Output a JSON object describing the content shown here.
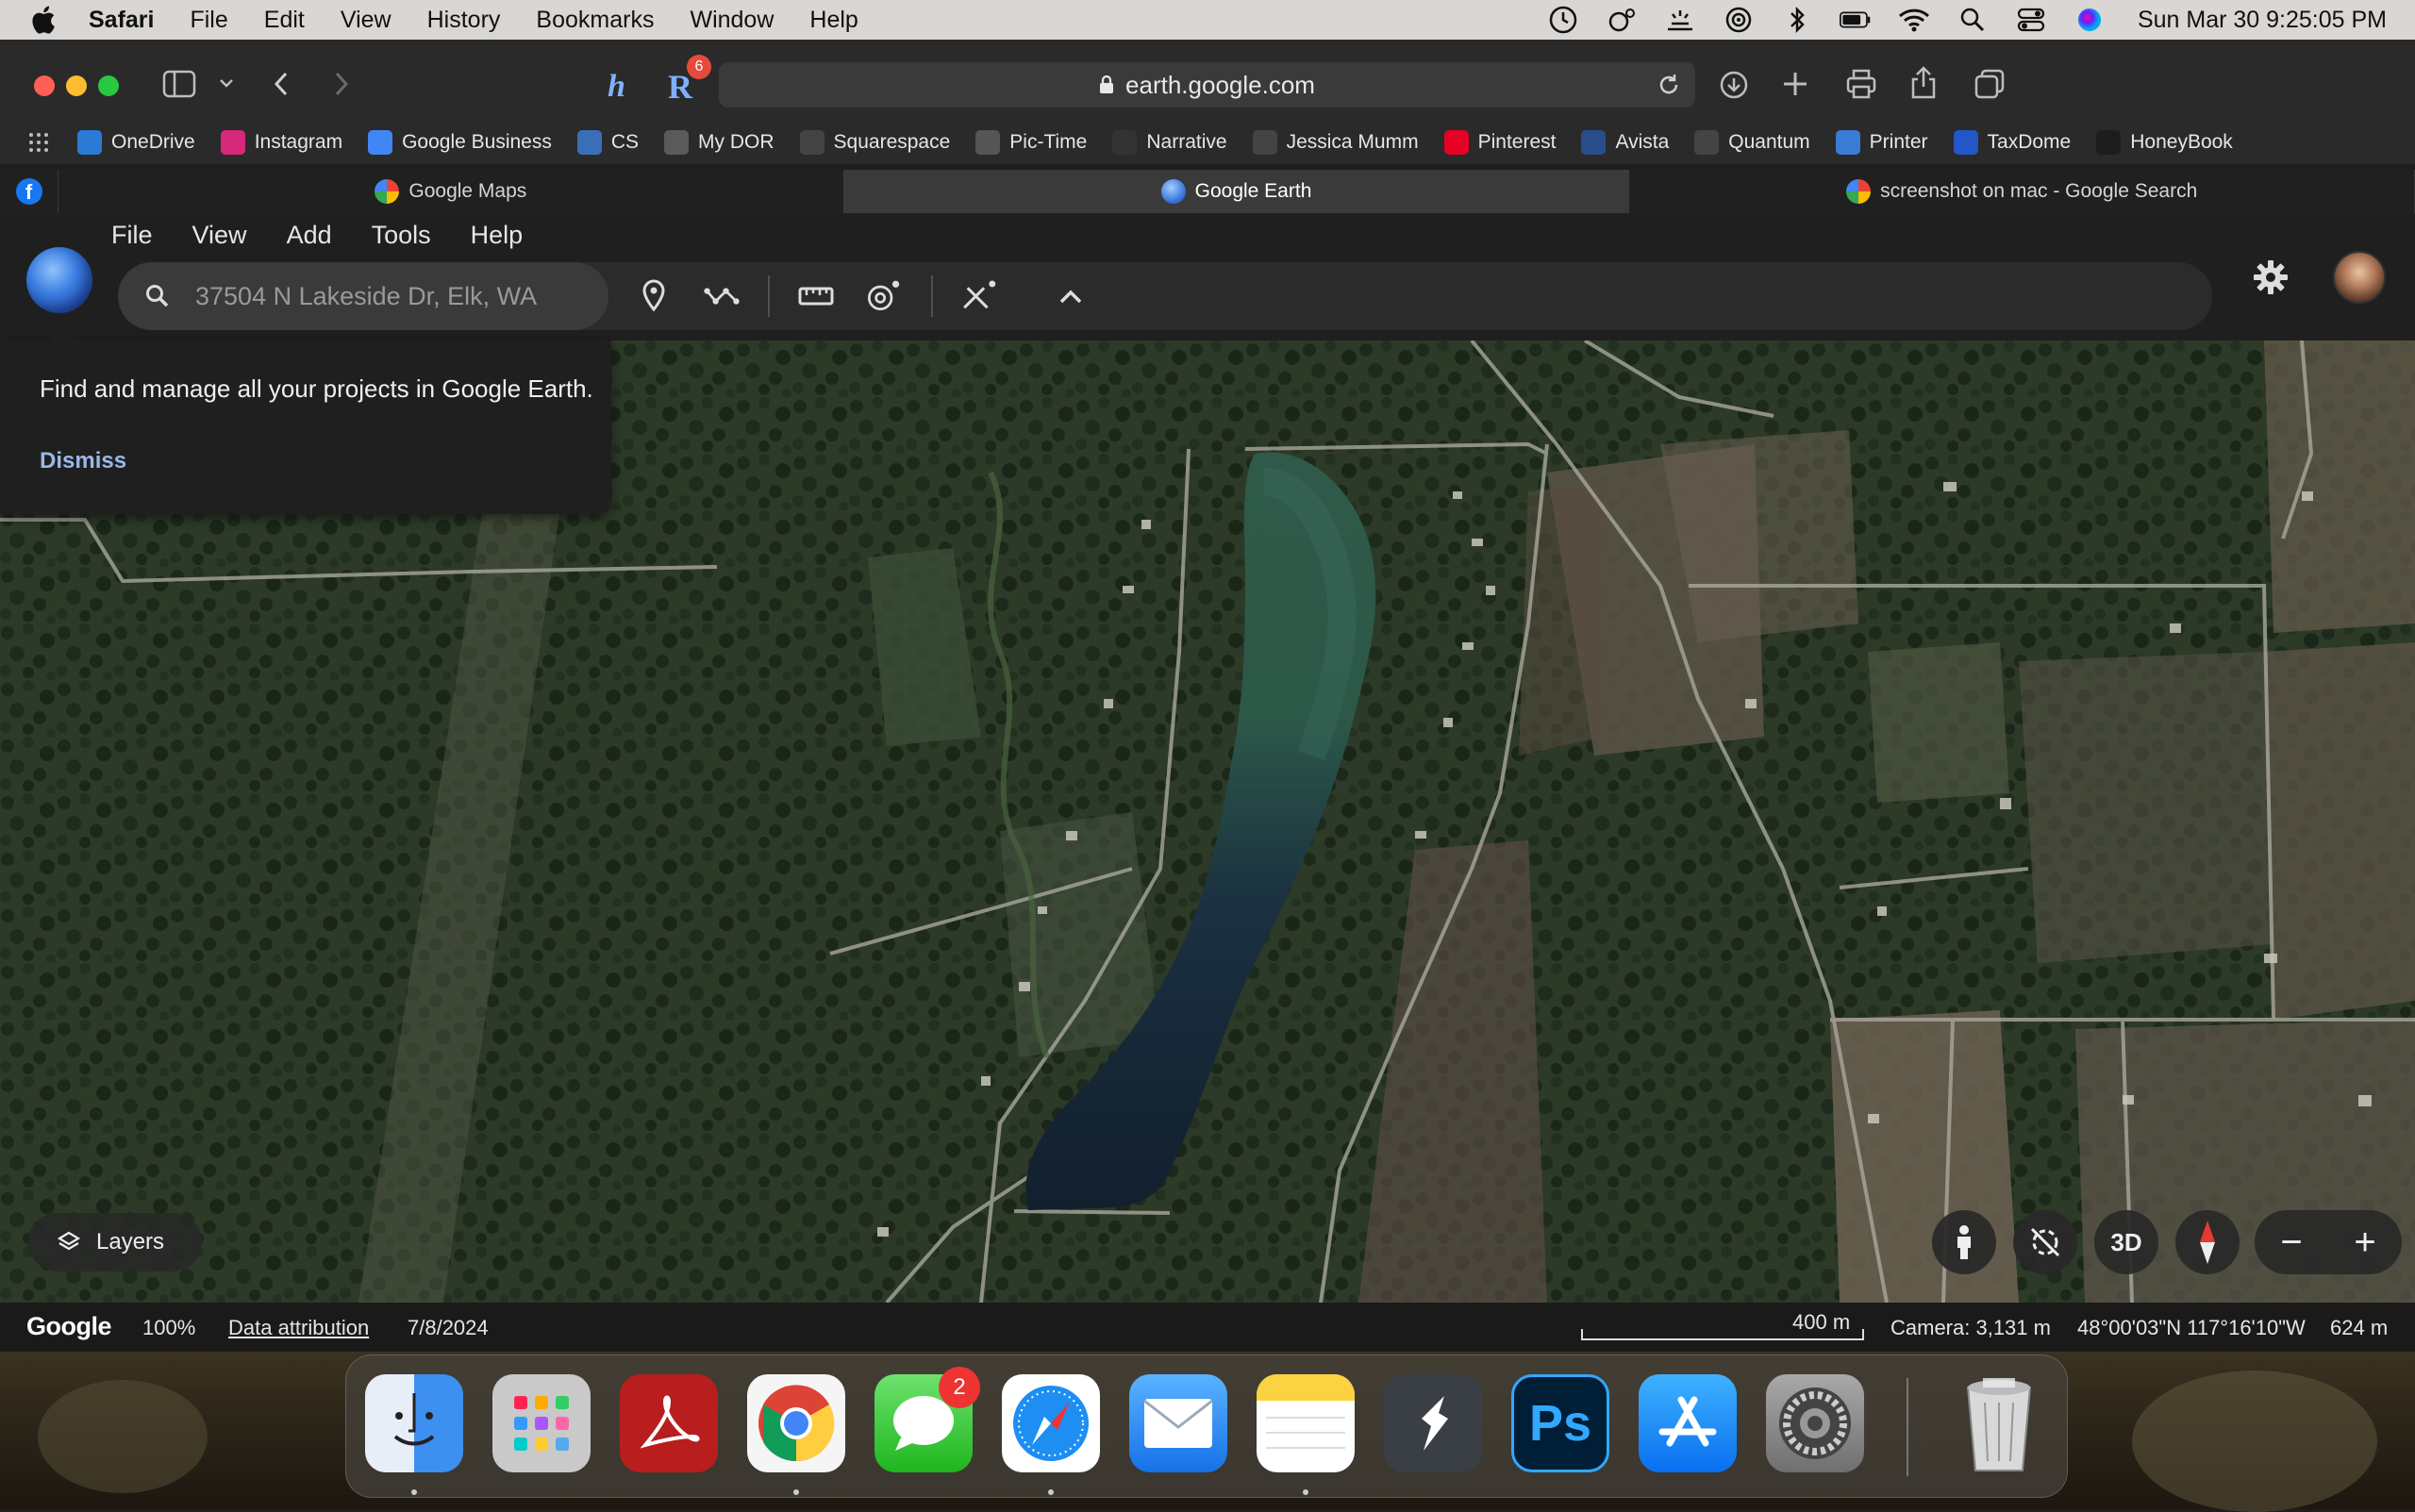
{
  "menubar": {
    "items": [
      "Safari",
      "File",
      "Edit",
      "View",
      "History",
      "Bookmarks",
      "Window",
      "Help"
    ],
    "clock": "Sun Mar 30  9:25:05 PM"
  },
  "browser": {
    "url": "earth.google.com",
    "extension_badge": "6"
  },
  "bookmarks": [
    {
      "label": "OneDrive",
      "color": "#2b7bd6",
      "icon": "onedrive-icon"
    },
    {
      "label": "Instagram",
      "color": "#d6297a",
      "icon": "instagram-icon"
    },
    {
      "label": "Google Business",
      "color": "#4285f4",
      "icon": "google-icon"
    },
    {
      "label": "CS",
      "color": "#3a6fb8",
      "icon": "cs-icon"
    },
    {
      "label": "My DOR",
      "color": "#5a5a5a",
      "icon": "dor-icon"
    },
    {
      "label": "Squarespace",
      "color": "#444444",
      "icon": "squarespace-icon"
    },
    {
      "label": "Pic-Time",
      "color": "#555555",
      "icon": "pictime-icon"
    },
    {
      "label": "Narrative",
      "color": "#333333",
      "icon": "narrative-icon"
    },
    {
      "label": "Jessica Mumm",
      "color": "#444444",
      "icon": "jessica-icon"
    },
    {
      "label": "Pinterest",
      "color": "#e60023",
      "icon": "pinterest-icon"
    },
    {
      "label": "Avista",
      "color": "#2a4d8c",
      "icon": "avista-icon"
    },
    {
      "label": "Quantum",
      "color": "#444444",
      "icon": "quantum-icon"
    },
    {
      "label": "Printer",
      "color": "#3a7bd5",
      "icon": "printer-icon"
    },
    {
      "label": "TaxDome",
      "color": "#2356c7",
      "icon": "taxdome-icon"
    },
    {
      "label": "HoneyBook",
      "color": "#1d1d1d",
      "icon": "honeybook-icon"
    }
  ],
  "tabs": [
    {
      "label": "Google Maps",
      "active": false
    },
    {
      "label": "Google Earth",
      "active": true
    },
    {
      "label": "screenshot on mac - Google Search",
      "active": false
    }
  ],
  "earth": {
    "menu": [
      "File",
      "View",
      "Add",
      "Tools",
      "Help"
    ],
    "search_placeholder": "37504 N Lakeside Dr, Elk, WA"
  },
  "tooltip": {
    "message": "Find and manage all your projects in Google Earth.",
    "dismiss": "Dismiss"
  },
  "map_controls": {
    "layers": "Layers",
    "three_d": "3D",
    "zoom_out": "−",
    "zoom_in": "+"
  },
  "status": {
    "brand": "Google",
    "zoom": "100%",
    "data_attribution": "Data attribution",
    "imagery_date": "7/8/2024",
    "scale": "400 m",
    "camera": "Camera: 3,131 m",
    "coords": "48°00'03\"N 117°16'10\"W",
    "elevation": "624 m"
  },
  "dock": {
    "apps": [
      "Finder",
      "Launchpad",
      "Acrobat",
      "Chrome",
      "Messages",
      "Safari",
      "Mail",
      "Notes",
      "Aspect",
      "Photoshop",
      "App Store",
      "System Settings",
      "Trash"
    ],
    "messages_badge": "2",
    "photoshop_label": "Ps"
  }
}
